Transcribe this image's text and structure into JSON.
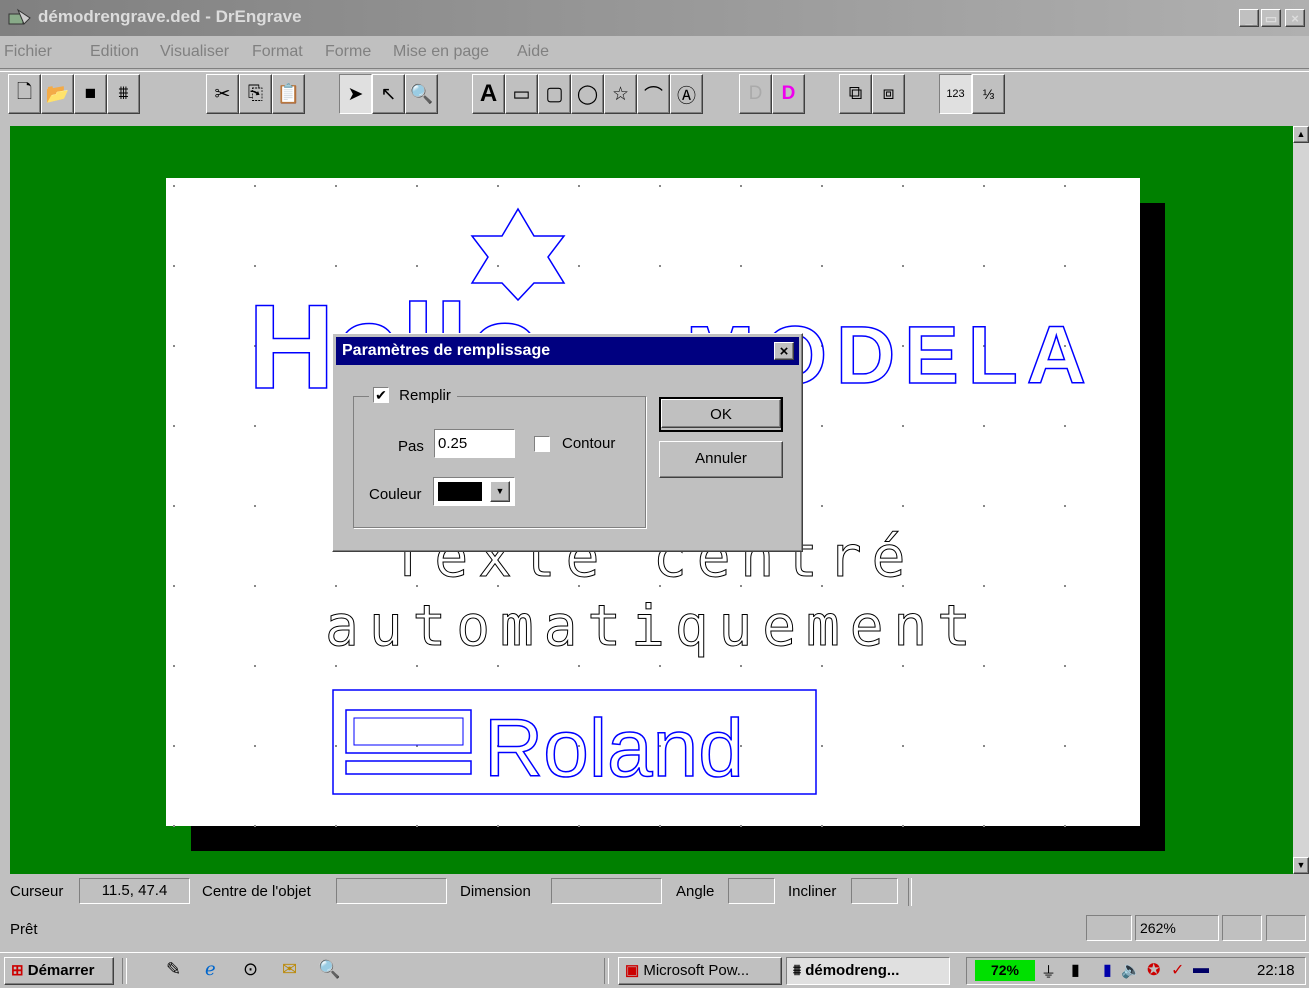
{
  "window": {
    "title": "démodrengrave.ded - DrEngrave",
    "min": "_",
    "max": "▯",
    "close": "×"
  },
  "menu": [
    "Fichier",
    "Edition",
    "Visualiser",
    "Format",
    "Forme",
    "Mise en page",
    "Aide"
  ],
  "toolbar_icons": [
    "new-icon",
    "open-icon",
    "save-icon",
    "engrave-icon",
    "cut-icon",
    "copy-icon",
    "paste-icon",
    "select-icon",
    "node-edit-icon",
    "zoom-icon",
    "text-icon",
    "rectangle-icon",
    "rounded-rectangle-icon",
    "ellipse-icon",
    "star-icon",
    "polyline-icon",
    "framed-text-icon",
    "font-d-icon",
    "font-d-color-icon",
    "group-icon",
    "ungroup-icon",
    "number-sequence-icon",
    "fraction-icon"
  ],
  "canvas": {
    "text_line1": "Texte centré",
    "text_line2": "automatiquement",
    "hello_text": "Hello",
    "modela_text": "MODELA",
    "logo_text": "Roland"
  },
  "dialog": {
    "title": "Paramètres de remplissage",
    "close": "×",
    "fill_label": "Remplir",
    "fill_checked": true,
    "step_label": "Pas",
    "step_value": "0.25",
    "outline_label": "Contour",
    "outline_checked": false,
    "color_label": "Couleur",
    "color_value": "#000000",
    "ok": "OK",
    "cancel": "Annuler"
  },
  "status": {
    "cursor_label": "Curseur",
    "cursor_value": "11.5, 47.4",
    "center_label": "Centre de l'objet",
    "center_value": "",
    "dimension_label": "Dimension",
    "dimension_value": "",
    "angle_label": "Angle",
    "angle_value": "",
    "tilt_label": "Incliner",
    "tilt_value": "",
    "ready": "Prêt",
    "zoom": "262%"
  },
  "taskbar": {
    "start": "Démarrer",
    "quicklaunch": [
      "desktop-icon",
      "ie-icon",
      "channels-icon",
      "outlook-icon",
      "explorer-icon"
    ],
    "tasks": [
      {
        "label": "Microsoft Pow...",
        "active": false
      },
      {
        "label": "démodreng...",
        "active": true
      }
    ],
    "battery": "72%",
    "clock": "22:18"
  },
  "colors": {
    "canvas_bg": "#008000",
    "dialog_title": "#000080",
    "outline_blue": "#0000ff",
    "fill_swatch": "#000000"
  }
}
